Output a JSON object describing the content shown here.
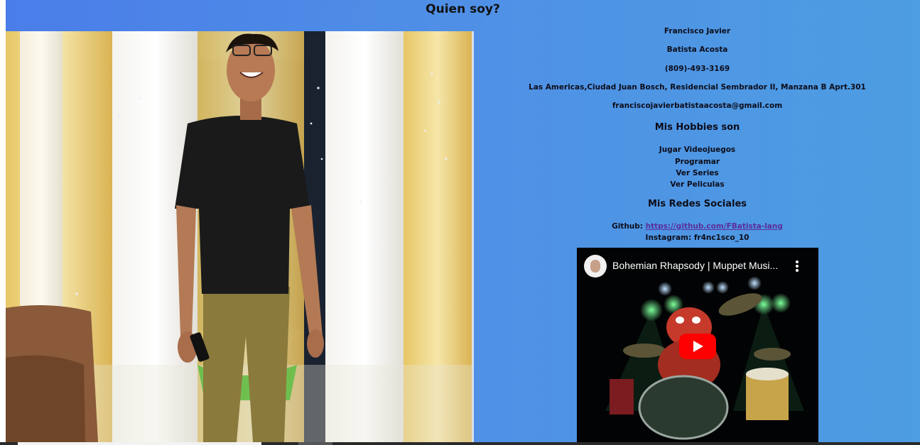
{
  "page": {
    "heading": "Quien soy?"
  },
  "profile": {
    "first_names": "Francisco Javier",
    "last_names": "Batista Acosta",
    "phone": "(809)-493-3169",
    "address": "Las Americas,Ciudad Juan Bosch, Residencial Sembrador II, Manzana B Aprt.301",
    "email": "franciscojavierbatistaacosta@gmail.com"
  },
  "hobbies": {
    "heading": "Mis Hobbies son",
    "items": [
      "Jugar Videojuegos",
      "Programar",
      "Ver Series",
      "Ver Peliculas"
    ]
  },
  "social": {
    "heading": "Mis Redes Sociales",
    "github_label": "Github:",
    "github_url": "https://github.com/FBatista-lang",
    "instagram": "Instagram: fr4nc1sco_10"
  },
  "video": {
    "title": "Bohemian Rhapsody | Muppet Musi...",
    "play_icon": "play-icon",
    "menu_icon": "more-vert-icon"
  },
  "colors": {
    "gradient_start": "#4a7de8",
    "gradient_end": "#4d9de2",
    "link": "#5a2f9a",
    "youtube_red": "#ff0000"
  }
}
